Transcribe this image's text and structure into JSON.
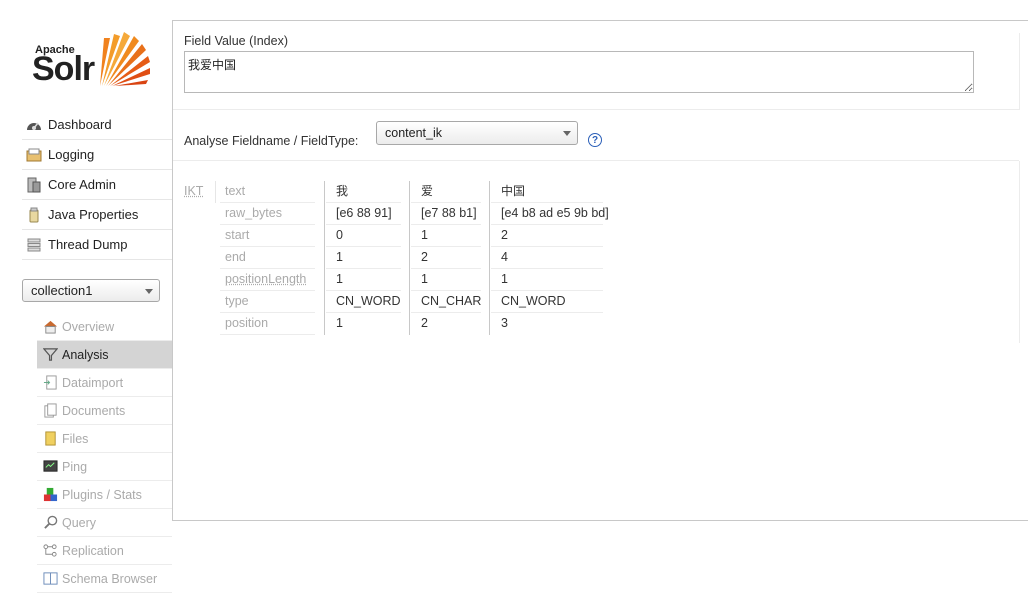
{
  "logo": {
    "apache": "Apache",
    "solr": "Solr"
  },
  "nav": [
    {
      "label": "Dashboard",
      "icon": "dashboard-icon"
    },
    {
      "label": "Logging",
      "icon": "logging-icon"
    },
    {
      "label": "Core Admin",
      "icon": "core-admin-icon"
    },
    {
      "label": "Java Properties",
      "icon": "java-properties-icon"
    },
    {
      "label": "Thread Dump",
      "icon": "thread-dump-icon"
    }
  ],
  "core_selector": {
    "value": "collection1"
  },
  "core_nav": [
    {
      "label": "Overview",
      "icon": "overview-icon"
    },
    {
      "label": "Analysis",
      "icon": "analysis-icon",
      "active": true
    },
    {
      "label": "Dataimport",
      "icon": "dataimport-icon"
    },
    {
      "label": "Documents",
      "icon": "documents-icon"
    },
    {
      "label": "Files",
      "icon": "files-icon"
    },
    {
      "label": "Ping",
      "icon": "ping-icon"
    },
    {
      "label": "Plugins / Stats",
      "icon": "plugins-icon"
    },
    {
      "label": "Query",
      "icon": "query-icon"
    },
    {
      "label": "Replication",
      "icon": "replication-icon"
    },
    {
      "label": "Schema Browser",
      "icon": "schema-browser-icon"
    }
  ],
  "analysis": {
    "field_value_label": "Field Value (Index)",
    "field_value": "我爱中国",
    "fieldtype_label": "Analyse Fieldname / FieldType:",
    "fieldtype_value": "content_ik",
    "help_label": "?",
    "tokenizer": "IKT",
    "attributes": [
      "text",
      "raw_bytes",
      "start",
      "end",
      "positionLength",
      "type",
      "position"
    ],
    "tokens": [
      {
        "text": "我",
        "raw_bytes": "[e6 88 91]",
        "start": "0",
        "end": "1",
        "positionLength": "1",
        "type": "CN_WORD",
        "position": "1"
      },
      {
        "text": "爱",
        "raw_bytes": "[e7 88 b1]",
        "start": "1",
        "end": "2",
        "positionLength": "1",
        "type": "CN_CHAR",
        "position": "2"
      },
      {
        "text": "中国",
        "raw_bytes": "[e4 b8 ad e5 9b bd]",
        "start": "2",
        "end": "4",
        "positionLength": "1",
        "type": "CN_WORD",
        "position": "3"
      }
    ]
  },
  "colors": {
    "active_bg": "#d4d4d4",
    "help_blue": "#2b5fb8",
    "logo_orange": "#f0821e"
  }
}
